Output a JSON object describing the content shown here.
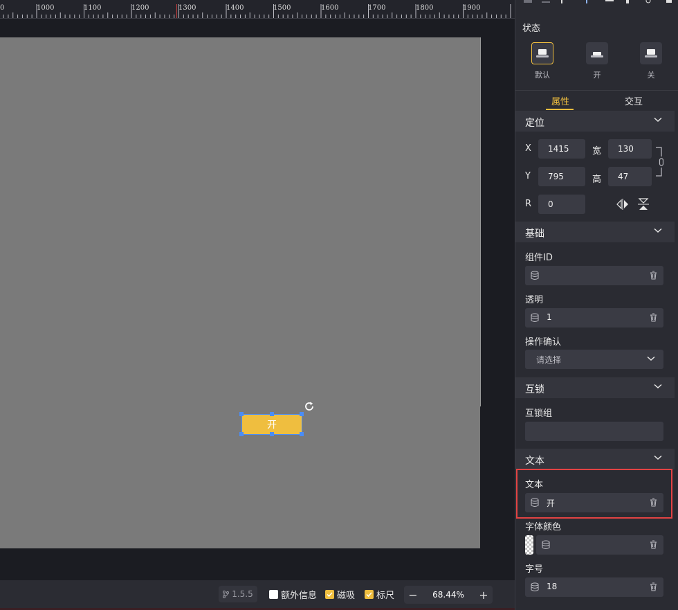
{
  "ruler": {
    "labels": [
      "0",
      "1000",
      "1100",
      "1200",
      "1300",
      "1400",
      "1500",
      "1600",
      "1700",
      "1800",
      "1900"
    ]
  },
  "canvas": {
    "selected_button_text": "开"
  },
  "bottombar": {
    "version": "1.5.5",
    "extra_info_label": "额外信息",
    "snap_label": "磁吸",
    "ruler_label": "标尺",
    "zoom": "68.44%"
  },
  "panel": {
    "state_title": "状态",
    "states": [
      {
        "label": "默认",
        "active": true
      },
      {
        "label": "开",
        "active": false
      },
      {
        "label": "关",
        "active": false
      }
    ],
    "tabs": {
      "properties": "属性",
      "interaction": "交互"
    },
    "position": {
      "title": "定位",
      "x_label": "X",
      "x_value": "1415",
      "w_label": "宽",
      "w_value": "130",
      "y_label": "Y",
      "y_value": "795",
      "h_label": "高",
      "h_value": "47",
      "r_label": "R",
      "r_value": "0"
    },
    "basic": {
      "title": "基础",
      "component_id_label": "组件ID",
      "component_id_value": "",
      "opacity_label": "透明",
      "opacity_value": "1",
      "confirm_label": "操作确认",
      "confirm_placeholder": "请选择"
    },
    "interlock": {
      "title": "互锁",
      "group_label": "互锁组",
      "group_value": ""
    },
    "text": {
      "title": "文本",
      "text_label": "文本",
      "text_value": "开",
      "font_color_label": "字体颜色",
      "font_color_value": "",
      "font_size_label": "字号",
      "font_size_value": "18"
    }
  },
  "colors": {
    "accent": "#efbe3f",
    "selection": "#4a8df7",
    "highlight": "#e24343",
    "canvas": "#7a7a7a"
  }
}
